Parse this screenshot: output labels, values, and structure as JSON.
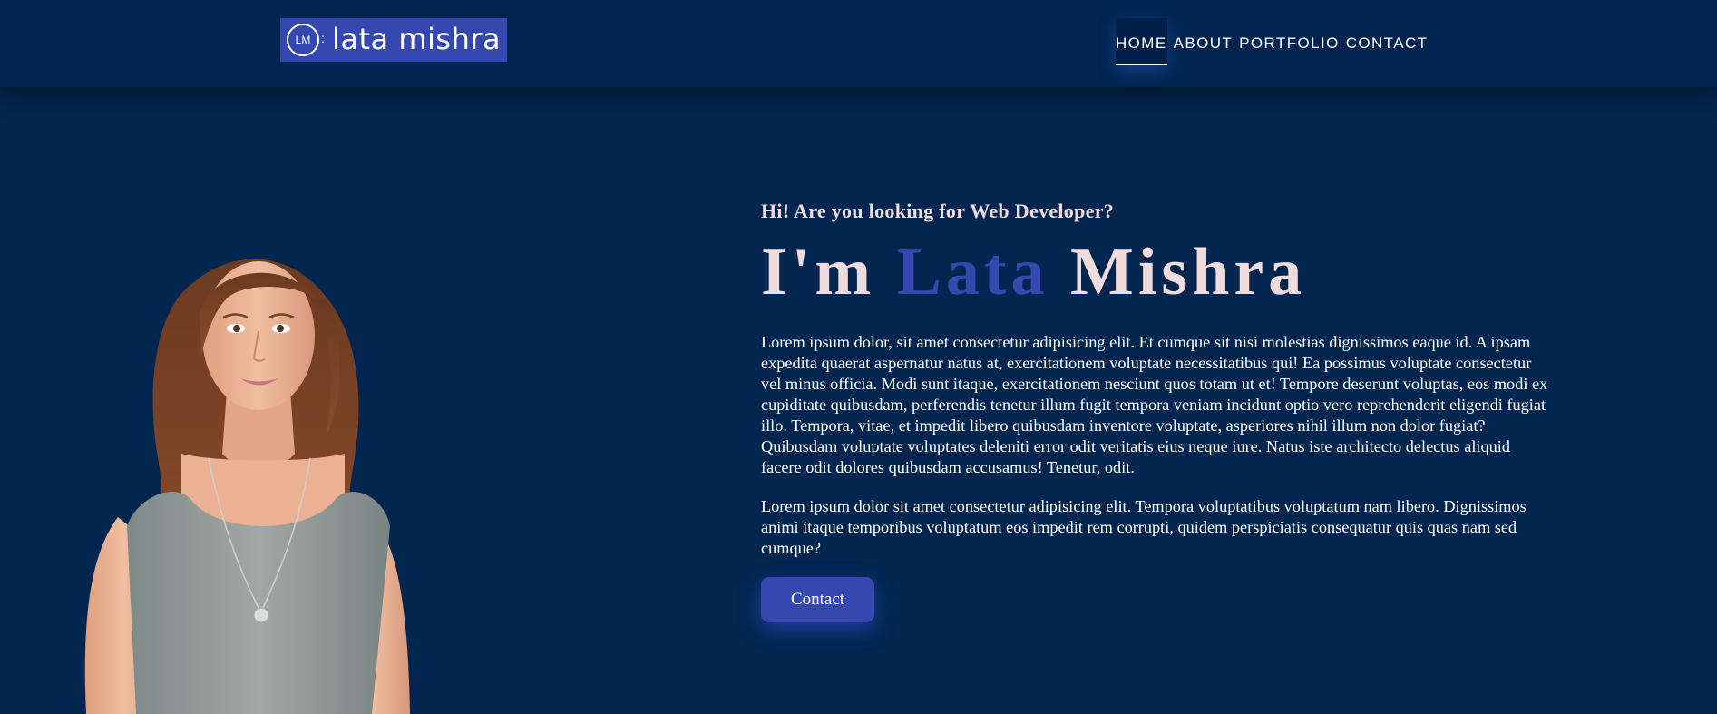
{
  "header": {
    "logo": {
      "badge": "LM",
      "text": "lata mishra"
    },
    "nav": [
      {
        "label": "HOME",
        "active": true
      },
      {
        "label": "ABOUT"
      },
      {
        "label": "PORTFOLIO"
      },
      {
        "label": "CONTACT"
      }
    ]
  },
  "hero": {
    "subtitle": "Hi! Are you looking for Web Developer?",
    "headline": {
      "prefix": "I'm",
      "first": "Lata",
      "last": "Mishra"
    },
    "paragraphs": [
      "Lorem ipsum dolor, sit amet consectetur adipisicing elit. Et cumque sit nisi molestias dignissimos eaque id. A ipsam expedita quaerat aspernatur natus at, exercitationem voluptate necessitatibus qui! Ea possimus voluptate consectetur vel minus officia. Modi sunt itaque, exercitationem nesciunt quos totam ut et! Tempore deserunt voluptas, eos modi ex cupiditate quibusdam, perferendis tenetur illum fugit tempora veniam incidunt optio vero reprehenderit eligendi fugiat illo. Tempora, vitae, et impedit libero quibusdam inventore voluptate, asperiores nihil illum non dolor fugiat? Quibusdam voluptate voluptates deleniti error odit veritatis eius neque iure. Natus iste architecto delectus aliquid facere odit dolores quibusdam accusamus! Tenetur, odit.",
      "Lorem ipsum dolor sit amet consectetur adipisicing elit. Tempora voluptatibus voluptatum nam libero. Dignissimos animi itaque temporibus voluptatum eos impedit rem corrupti, quidem perspiciatis consequatur quis quas nam sed cumque?"
    ],
    "cta_label": "Contact"
  },
  "colors": {
    "background": "#022650",
    "accent": "#3548b0",
    "heading": "#f0dcdc",
    "text": "#ffffff"
  }
}
